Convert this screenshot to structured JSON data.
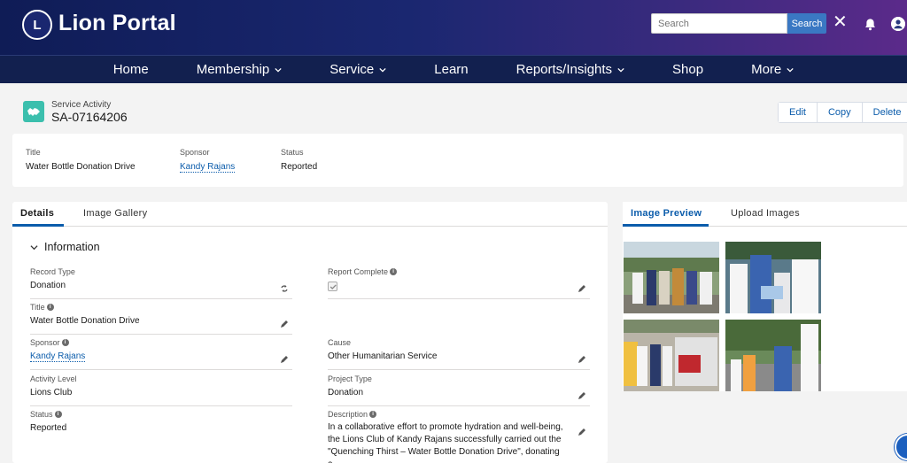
{
  "header": {
    "logo_text": "L",
    "brand": "Lion Portal",
    "search_placeholder": "Search",
    "search_button": "Search",
    "close_glyph": "✕"
  },
  "nav": {
    "items": [
      "Home",
      "Membership",
      "Service",
      "Learn",
      "Reports/Insights",
      "Shop",
      "More"
    ]
  },
  "record": {
    "object_type": "Service Activity",
    "record_id": "SA-07164206",
    "actions": [
      "Edit",
      "Copy",
      "Delete"
    ]
  },
  "highlights": {
    "title_label": "Title",
    "title_value": "Water Bottle Donation Drive",
    "sponsor_label": "Sponsor",
    "sponsor_value": "Kandy Rajans",
    "status_label": "Status",
    "status_value": "Reported"
  },
  "details": {
    "tabs": [
      "Details",
      "Image Gallery"
    ],
    "section_title": "Information",
    "fields": {
      "record_type_label": "Record Type",
      "record_type_value": "Donation",
      "report_complete_label": "Report Complete",
      "title_label": "Title",
      "title_value": "Water Bottle Donation Drive",
      "sponsor_label": "Sponsor",
      "sponsor_value": "Kandy Rajans",
      "cause_label": "Cause",
      "cause_value": "Other Humanitarian Service",
      "activity_level_label": "Activity Level",
      "activity_level_value": "Lions Club",
      "project_type_label": "Project Type",
      "project_type_value": "Donation",
      "status_label": "Status",
      "status_value": "Reported",
      "description_label": "Description",
      "description_value": "In a collaborative effort to promote hydration and well-being, the Lions Club of Kandy Rajans successfully carried out the \"Quenching Thirst – Water Bottle Donation Drive\", donating a"
    }
  },
  "image_panel": {
    "tabs": [
      "Image Preview",
      "Upload Images"
    ]
  },
  "colors": {
    "header_start": "#0f1c56",
    "header_end": "#5b2a8a",
    "nav_bg": "#12204f",
    "accent": "#0b5cab",
    "record_icon": "#3bbfad"
  }
}
